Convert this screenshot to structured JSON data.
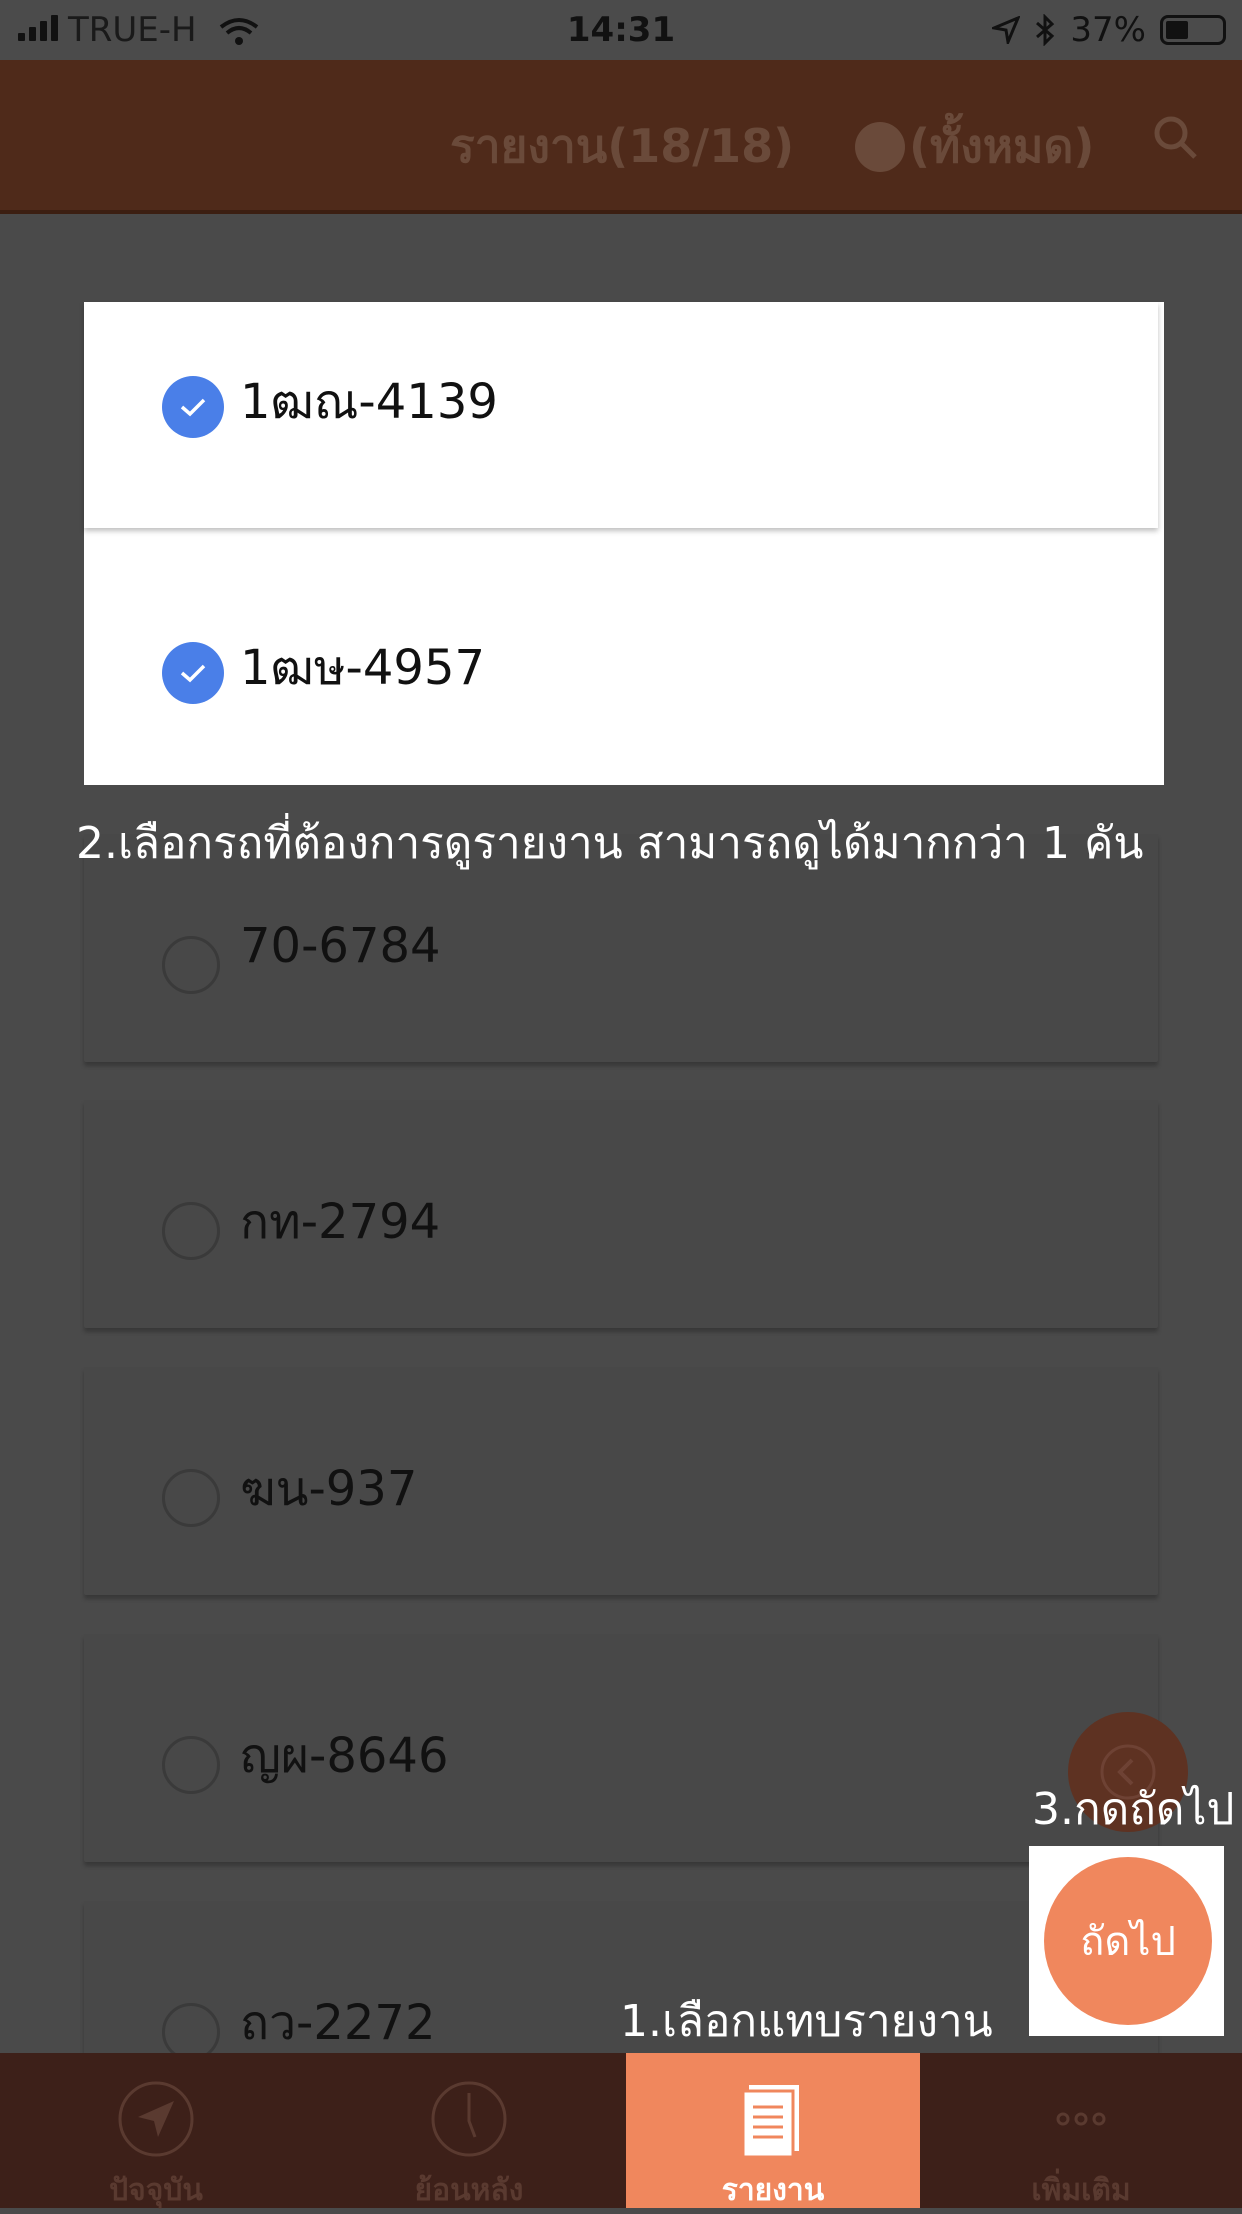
{
  "status_bar": {
    "carrier": "TRUE-H",
    "time": "14:31",
    "battery": "37%"
  },
  "app_bar": {
    "title": "รายงาน(18/18)",
    "filter": "(ทั้งหมด)"
  },
  "vehicles": [
    {
      "plate": "1ฒณ-4139",
      "selected": true
    },
    {
      "plate": "1ฒษ-4957",
      "selected": true
    },
    {
      "plate": "70-6784",
      "selected": false
    },
    {
      "plate": "กท-2794",
      "selected": false
    },
    {
      "plate": "ฆน-937",
      "selected": false
    },
    {
      "plate": "ญผ-8646",
      "selected": false
    },
    {
      "plate": "ถว-2272",
      "selected": false
    }
  ],
  "tutorial": {
    "step1": "1.เลือกแทบรายงาน",
    "step2": "2.เลือกรถที่ต้องการดูรายงาน สามารถดูได้มากกว่า 1 คัน",
    "step3": "3.กดถัดไป"
  },
  "next_button": "ถัดไป",
  "tabs": [
    {
      "label": "ปัจจุบัน",
      "icon": "navigation-arrow-icon"
    },
    {
      "label": "ย้อนหลัง",
      "icon": "clock-icon"
    },
    {
      "label": "รายงาน",
      "icon": "report-document-icon",
      "active": true
    },
    {
      "label": "เพิ่มเติม",
      "icon": "more-dots-icon"
    }
  ],
  "colors": {
    "accent": "#f0875d",
    "appbar": "#4f2a1a",
    "check": "#4a7fe8"
  }
}
